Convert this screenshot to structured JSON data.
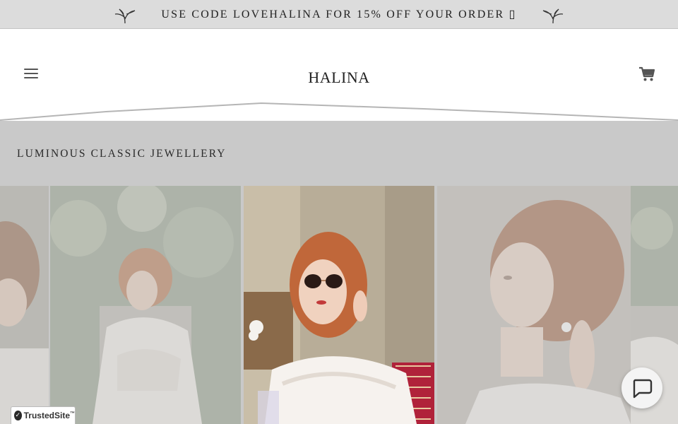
{
  "announcement": {
    "text": "USE CODE LOVEHALINA FOR 15% OFF YOUR ORDER ▯"
  },
  "header": {
    "logo": "HALINA",
    "menu_icon": "hamburger-icon",
    "cart_icon": "cart-icon"
  },
  "hero": {
    "tagline": "LUMINOUS CLASSIC JEWELLERY"
  },
  "gallery": {
    "items": [
      {
        "icon": "photo-model-partial-left",
        "active": false
      },
      {
        "icon": "photo-model-white-dress",
        "active": false
      },
      {
        "icon": "photo-model-sunglasses",
        "active": true
      },
      {
        "icon": "photo-model-profile-earring",
        "active": false
      },
      {
        "icon": "photo-model-partial-right",
        "active": false
      }
    ]
  },
  "chat": {
    "icon": "chat-bubble-icon"
  },
  "trust_badge": {
    "label": "TrustedSite",
    "mark": "™"
  },
  "colors": {
    "announcement_bg": "#dcdcdc",
    "page_bg": "#c9c9c9",
    "header_bg": "#ffffff",
    "text": "#222222"
  }
}
